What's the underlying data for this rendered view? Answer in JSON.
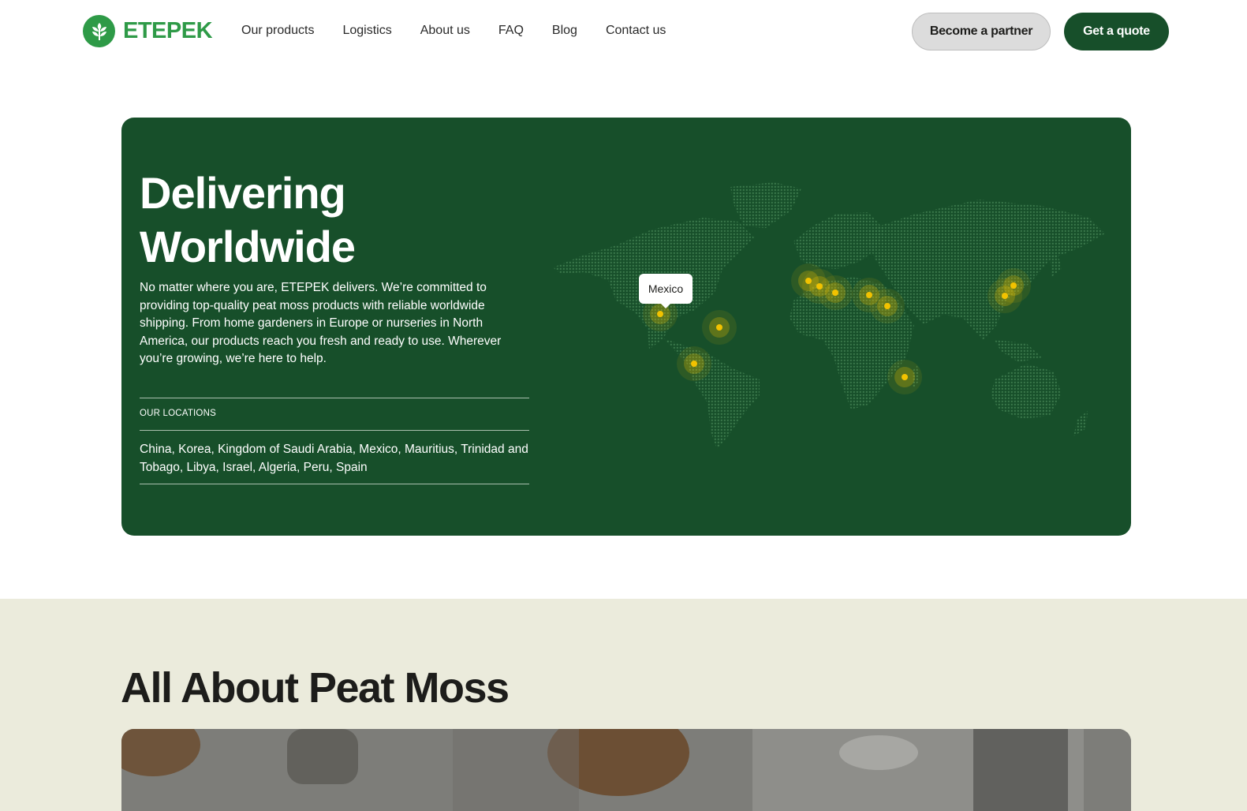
{
  "header": {
    "logo_text": "ETEPEK",
    "nav": [
      "Our products",
      "Logistics",
      "About us",
      "FAQ",
      "Blog",
      "Contact us"
    ],
    "partner_button": "Become a partner",
    "quote_button": "Get a quote"
  },
  "hero": {
    "title_line1": "Delivering",
    "title_line2": "Worldwide",
    "description": "No matter where you are, ETEPEK delivers. We’re committed to providing top-quality peat moss products with reliable worldwide shipping. From home gardeners in Europe or nurseries in North America, our products reach you fresh and ready to use. Wherever you’re growing, we’re here to help.",
    "locations_label": "OUR LOCATIONS",
    "locations": "China, Korea, Kingdom of Saudi Arabia, Mexico, Mauritius, Trinidad and Tobago, Libya, Israel, Algeria, Peru, Spain",
    "tooltip": "Mexico",
    "colors": {
      "card": "#174f2a",
      "marker": "#f2c200",
      "map_dots": "#3c7a4c"
    }
  },
  "peat_section": {
    "title": "All About Peat Moss",
    "background": "#ebebdc"
  }
}
